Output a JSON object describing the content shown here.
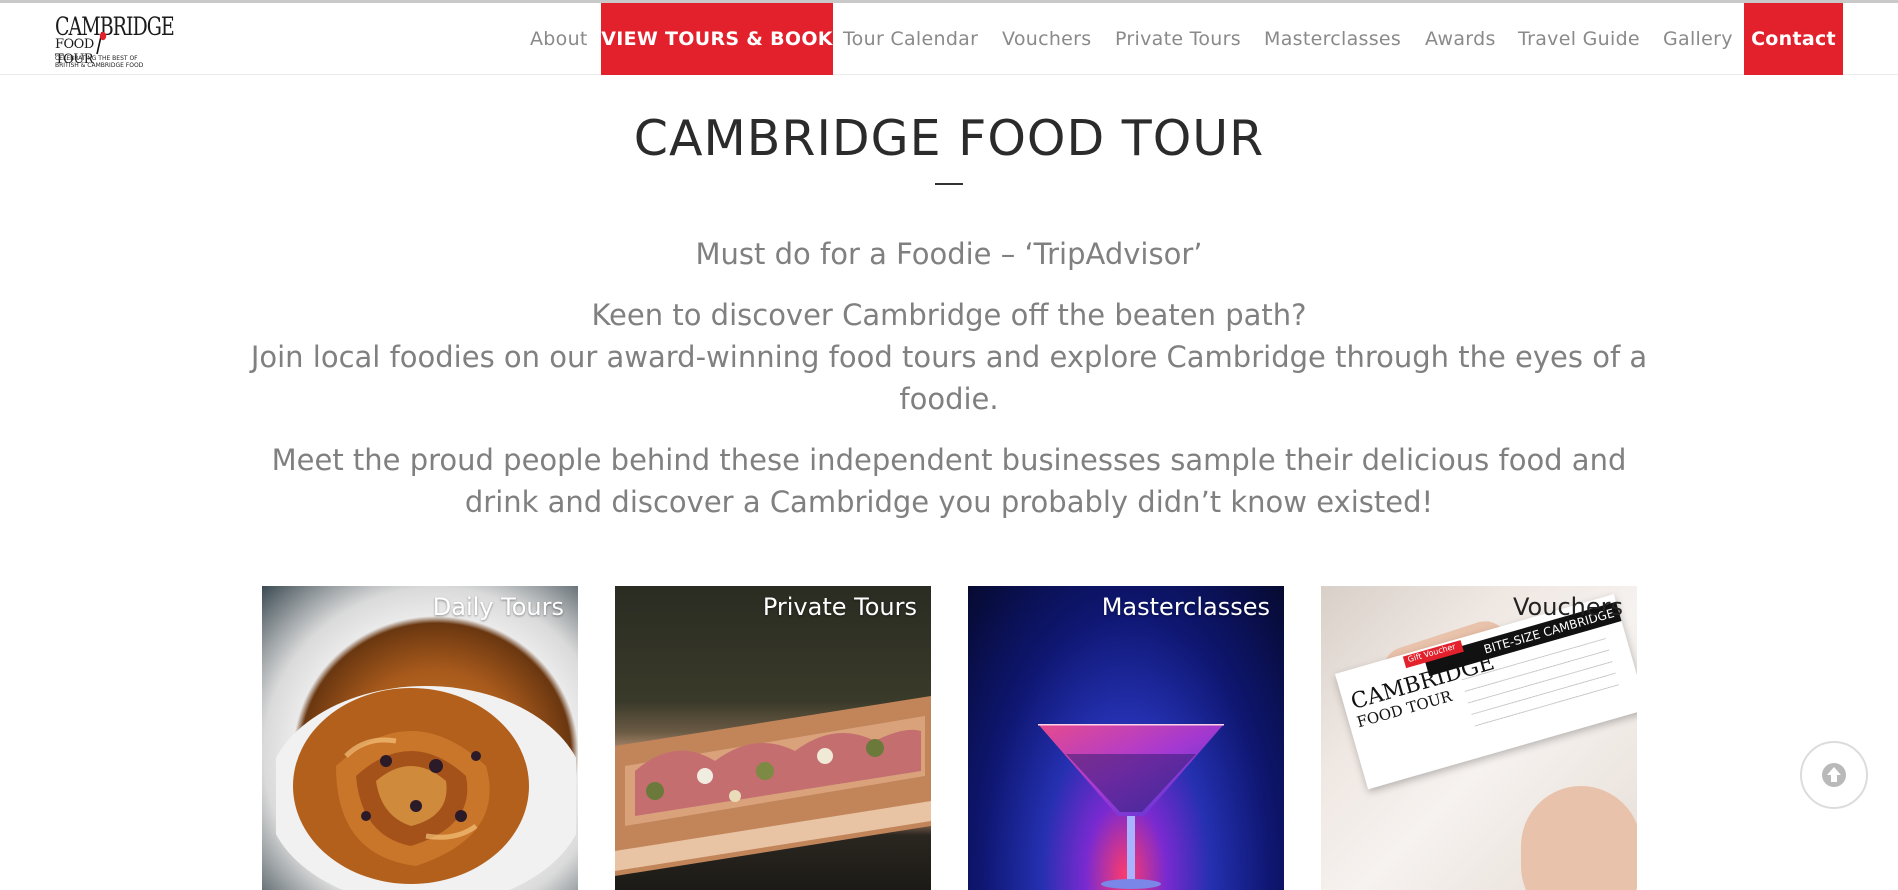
{
  "logo": {
    "line1": "CAMBRIDGE",
    "line2a": "FOOD",
    "line2b": "TOUR",
    "tagline_left": "CELEBRATING",
    "tagline_right": "THE BEST OF",
    "tagline_bottom": "BRITISH & CAMBRIDGE FOOD"
  },
  "nav": {
    "items": [
      {
        "label": "About"
      },
      {
        "label": "VIEW TOURS & BOOK"
      },
      {
        "label": "Tour Calendar"
      },
      {
        "label": "Vouchers"
      },
      {
        "label": "Private Tours"
      },
      {
        "label": "Masterclasses"
      },
      {
        "label": "Awards"
      },
      {
        "label": "Travel Guide"
      },
      {
        "label": "Gallery"
      },
      {
        "label": "Contact"
      }
    ],
    "accent_color": "#e3212d"
  },
  "main": {
    "title": "CAMBRIDGE FOOD TOUR",
    "quote": "Must do for a Foodie – ‘TripAdvisor’",
    "intro_line1": "Keen to discover Cambridge off the beaten path?",
    "intro_line2": "Join local foodies on our award-winning food tours and explore Cambridge through the eyes of a foodie.",
    "outro": "Meet the proud people behind these independent businesses sample their delicious food and drink and discover a Cambridge you probably didn’t know existed!"
  },
  "cards": [
    {
      "label": "Daily Tours",
      "icon": "pastry-image"
    },
    {
      "label": "Private Tours",
      "icon": "flatbread-image"
    },
    {
      "label": "Masterclasses",
      "icon": "cocktail-image"
    },
    {
      "label": "Vouchers",
      "icon": "voucher-image"
    }
  ],
  "voucher_card": {
    "tag": "Gift Voucher",
    "heading": "BITE-SIZE CAMBRIDGE",
    "brand1": "CAMBRIDGE",
    "brand2": "FOOD TOUR"
  },
  "scroll_top": {
    "icon": "arrow-up-icon"
  }
}
